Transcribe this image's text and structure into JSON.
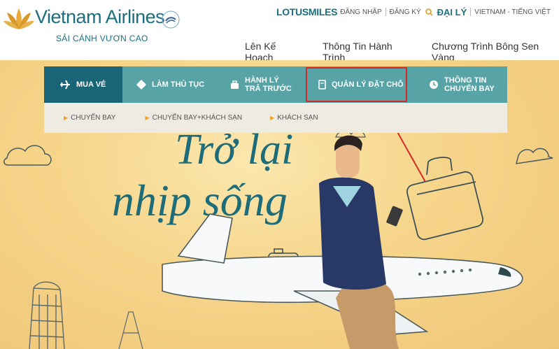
{
  "header": {
    "brand": "Vietnam Airlines",
    "slogan": "SẢI CÁNH VƯƠN CAO",
    "lotusmiles": "LOTUSMILES",
    "login": "ĐĂNG NHẬP",
    "register": "ĐĂNG KÝ",
    "agent": "ĐẠI LÝ",
    "region_language": "VIETNAM - TIẾNG VIỆT",
    "nav": [
      "Lên Kế Hoạch",
      "Thông Tin Hành Trình",
      "Chương Trình Bông Sen Vàng"
    ]
  },
  "booking": {
    "tabs": [
      {
        "line1": "MUA VÉ",
        "line2": "",
        "icon": "plane-icon",
        "active": true
      },
      {
        "line1": "LÀM THỦ TỤC",
        "line2": "",
        "icon": "ticket-icon"
      },
      {
        "line1": "HÀNH LÝ",
        "line2": "TRẢ TRƯỚC",
        "icon": "suitcase-icon"
      },
      {
        "line1": "QUẢN LÝ ĐẶT CHỖ",
        "line2": "",
        "icon": "document-icon",
        "highlighted": true
      },
      {
        "line1": "THÔNG TIN",
        "line2": "CHUYẾN BAY",
        "icon": "clock-icon"
      }
    ],
    "subtabs": [
      "CHUYẾN BAY",
      "CHUYẾN BAY+KHÁCH SẠN",
      "KHÁCH SẠN"
    ]
  },
  "hero": {
    "headline_line1": "Trở lại",
    "headline_line2": "nhịp sống"
  },
  "colors": {
    "brand_teal": "#1b6f80",
    "tab_bg": "#58a3a6",
    "tab_active": "#1a6478",
    "highlight_red": "#d62a28",
    "accent_orange": "#f0a020"
  }
}
